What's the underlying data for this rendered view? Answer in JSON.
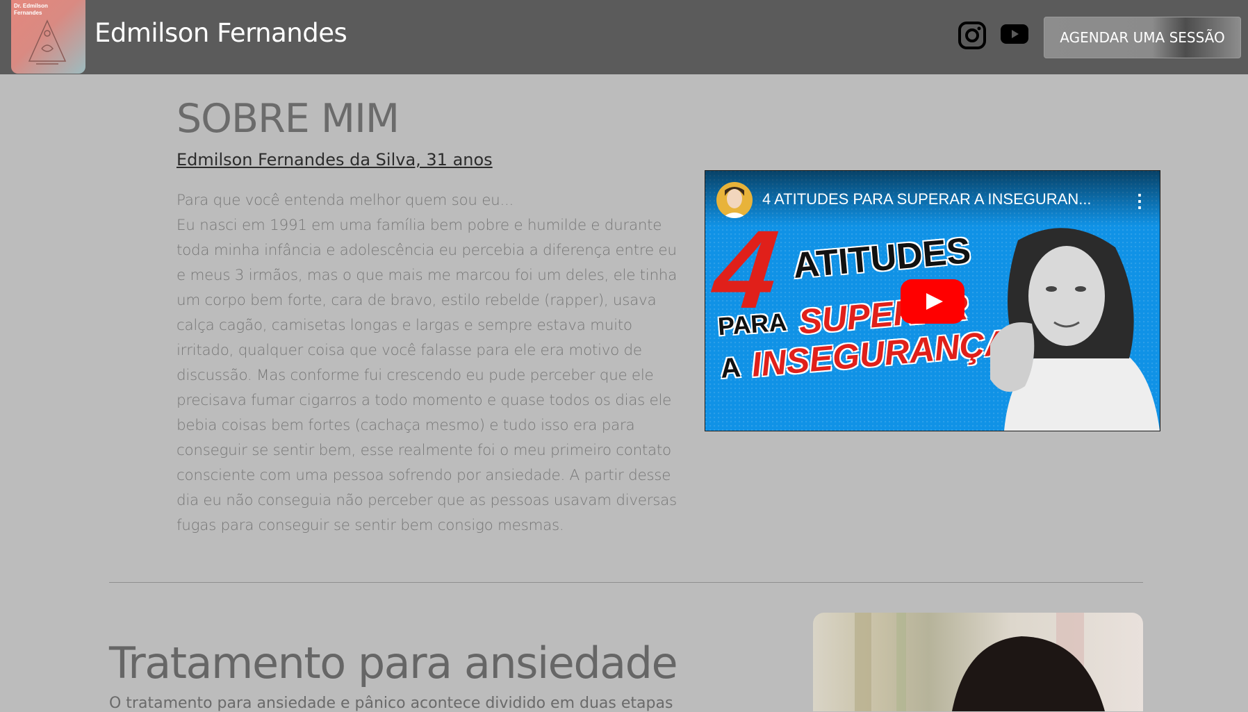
{
  "header": {
    "logo_text": "Dr. Edmilson Fernandes",
    "brand": "Edmilson Fernandes",
    "social": [
      "instagram-icon",
      "youtube-icon"
    ],
    "cta_label": "AGENDAR UMA SESSÃO"
  },
  "about": {
    "title": "SOBRE MIM",
    "subtitle": "Edmilson Fernandes da Silva, 31 anos",
    "intro": "Para que você entenda melhor quem sou eu...",
    "body": "Eu nasci em 1991 em uma família bem pobre e humilde e durante toda minha infância e adolescência eu percebia a diferença entre eu e meus 3 irmãos, mas o que mais me marcou foi um deles, ele tinha um corpo bem forte, cara de bravo, estilo rebelde (rapper), usava calça cagão, camisetas longas e largas e sempre estava muito irritado, qualquer coisa que você falasse para ele era motivo de discussão. Mas conforme fui crescendo eu pude perceber que ele precisava fumar cigarros a todo momento e quase todos os dias ele bebia coisas bem fortes (cachaça mesmo) e tudo isso era para conseguir se sentir bem, esse realmente foi o meu primeiro contato consciente com uma pessoa sofrendo por ansiedade. A partir desse dia eu não conseguia não perceber que as pessoas usavam diversas fugas para conseguir se sentir bem consigo mesmas."
  },
  "video": {
    "title": "4 ATITUDES PARA SUPERAR A INSEGURAN...",
    "menu": "⋮",
    "thumb_number": "4",
    "thumb_line1": "ATITUDES",
    "thumb_line2a": "PARA",
    "thumb_line2b": "SUPERAR",
    "thumb_line3a": "A",
    "thumb_line3b": "INSEGURANÇA"
  },
  "treatment": {
    "title": "Tratamento para ansiedade",
    "text": "O tratamento para ansiedade e pânico acontece dividido em duas etapas"
  },
  "colors": {
    "header_bg": "#5b5b5b",
    "page_bg": "#bcbcbc",
    "video_bg": "#1092e6",
    "accent_red": "#e0201a"
  }
}
